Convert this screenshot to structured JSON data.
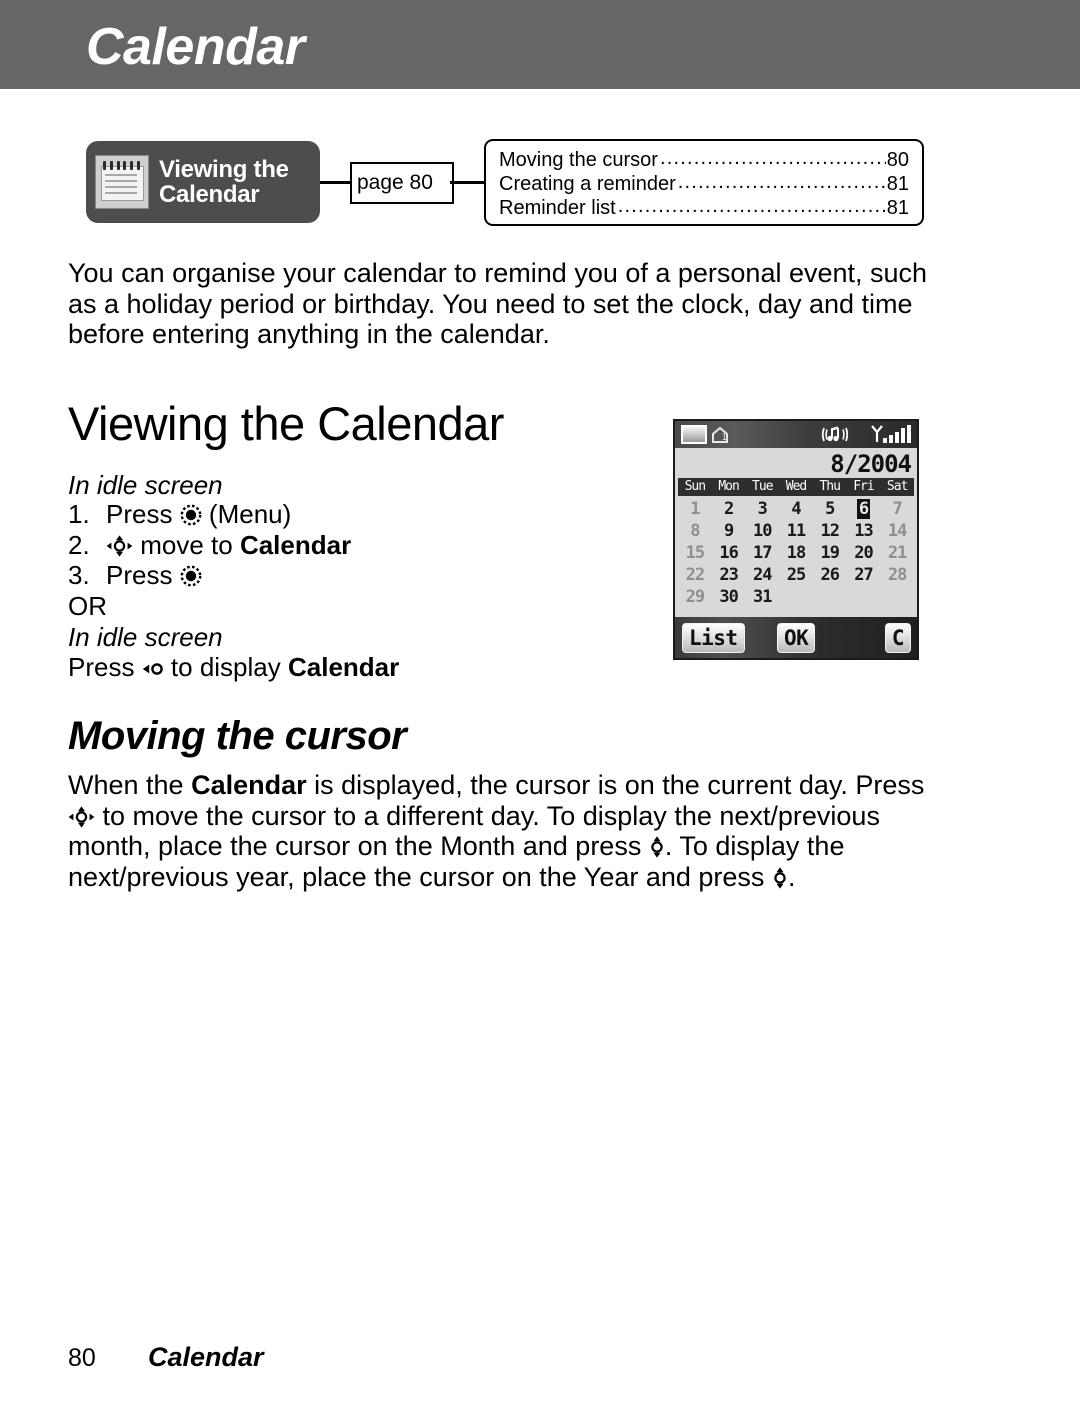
{
  "header": {
    "title": "Calendar"
  },
  "badge": {
    "icon": "calendar-icon",
    "line1": "Viewing the",
    "line2": "Calendar",
    "page_ref": "page 80"
  },
  "toc": {
    "entries": [
      {
        "label": "Moving the cursor",
        "page": "80"
      },
      {
        "label": "Creating a reminder",
        "page": "81"
      },
      {
        "label": "Reminder list",
        "page": "81"
      }
    ]
  },
  "intro": {
    "text": "You can organise your calendar to remind you of a personal event, such as a holiday period or birthday. You need to set the clock, day and time before entering anything in the calendar."
  },
  "section1": {
    "heading": "Viewing the Calendar",
    "idle_label": "In idle screen",
    "steps": [
      {
        "num": "1.",
        "before": "Press ",
        "icon": "select-key-icon",
        "after": " (Menu)"
      },
      {
        "num": "2.",
        "before": "",
        "icon": "nav-4way-key-icon",
        "after": " move to ",
        "bold": "Calendar"
      },
      {
        "num": "3.",
        "before": "Press ",
        "icon": "select-key-icon",
        "after": ""
      }
    ],
    "or": "OR",
    "idle_label2": "In idle screen",
    "alt_before": "Press ",
    "alt_icon": "left-key-icon",
    "alt_after": " to display ",
    "alt_bold": "Calendar"
  },
  "phone_screen": {
    "status": {
      "battery": "battery-icon",
      "home": "home-icon",
      "music": "music-icon",
      "signal": "signal-icon"
    },
    "date": "8/2004",
    "weekdays": [
      "Sun",
      "Mon",
      "Tue",
      "Wed",
      "Thu",
      "Fri",
      "Sat"
    ],
    "weeks": [
      [
        "1",
        "2",
        "3",
        "4",
        "5",
        "6",
        "7"
      ],
      [
        "8",
        "9",
        "10",
        "11",
        "12",
        "13",
        "14"
      ],
      [
        "15",
        "16",
        "17",
        "18",
        "19",
        "20",
        "21"
      ],
      [
        "22",
        "23",
        "24",
        "25",
        "26",
        "27",
        "28"
      ],
      [
        "29",
        "30",
        "31",
        "",
        "",
        "",
        ""
      ]
    ],
    "selected_day": "6",
    "softkeys": {
      "left": "List",
      "middle": "OK",
      "right": "C"
    }
  },
  "section2": {
    "heading": "Moving the cursor",
    "p_a": "When the ",
    "p_b": "Calendar",
    "p_c": " is displayed, the cursor is on the current day. Press ",
    "icon1": "nav-4way-key-icon",
    "p_d": " to move the cursor to a different day. To display the next/previous month, place the cursor on the Month and press ",
    "icon2": "nav-updown-key-icon",
    "p_e": ". To display the next/previous year, place the cursor on the Year and press ",
    "icon3": "nav-updown-key-icon",
    "p_f": "."
  },
  "footer": {
    "page_number": "80",
    "chapter": "Calendar"
  }
}
